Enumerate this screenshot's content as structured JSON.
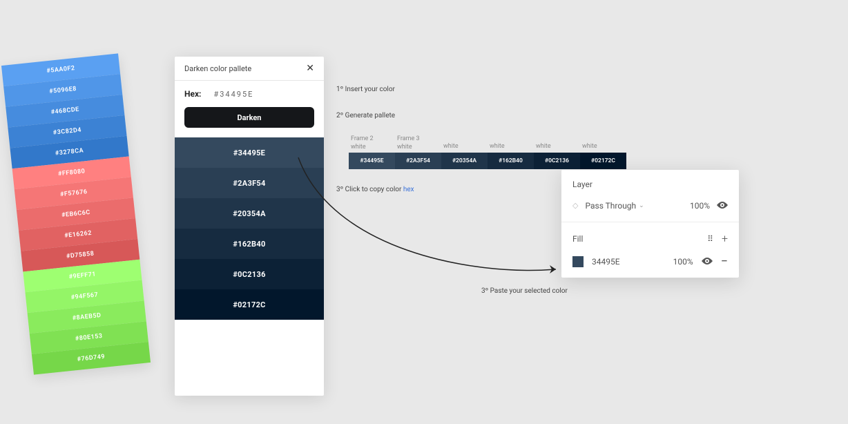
{
  "tilted": [
    {
      "hex": "#5AA0F2"
    },
    {
      "hex": "#5096E8"
    },
    {
      "hex": "#468CDE"
    },
    {
      "hex": "#3C82D4"
    },
    {
      "hex": "#3278CA"
    },
    {
      "hex": "#FF8080"
    },
    {
      "hex": "#F57676"
    },
    {
      "hex": "#EB6C6C"
    },
    {
      "hex": "#E16262"
    },
    {
      "hex": "#D75858"
    },
    {
      "hex": "#9EFF71"
    },
    {
      "hex": "#94F567"
    },
    {
      "hex": "#8AEB5D"
    },
    {
      "hex": "#80E153"
    },
    {
      "hex": "#76D749"
    }
  ],
  "plugin": {
    "title": "Darken color pallete",
    "hex_label": "Hex:",
    "hex_value": "#34495E",
    "button": "Darken",
    "results": [
      {
        "hex": "#34495E"
      },
      {
        "hex": "#2A3F54"
      },
      {
        "hex": "#20354A"
      },
      {
        "hex": "#162B40"
      },
      {
        "hex": "#0C2136"
      },
      {
        "hex": "#02172C"
      }
    ]
  },
  "steps": {
    "s1": "1º Insert your color",
    "s2": "2º Generate pallete",
    "s3_prefix": "3º Click to copy color ",
    "s3_link": "hex",
    "s4": "3º Paste your selected color"
  },
  "frames": {
    "header1_a": "Frame 2",
    "header1_b": "white",
    "header2_a": "Frame 3",
    "header2_b": "white",
    "header_white": "white",
    "chips": [
      {
        "hex": "#34495E"
      },
      {
        "hex": "#2A3F54"
      },
      {
        "hex": "#20354A"
      },
      {
        "hex": "#162B40"
      },
      {
        "hex": "#0C2136"
      },
      {
        "hex": "#02172C"
      }
    ]
  },
  "inspector": {
    "layer_title": "Layer",
    "blend_mode": "Pass Through",
    "blend_opacity": "100%",
    "fill_title": "Fill",
    "fill_hex": "34495E",
    "fill_opacity": "100%",
    "fill_swatch_color": "#34495E"
  }
}
